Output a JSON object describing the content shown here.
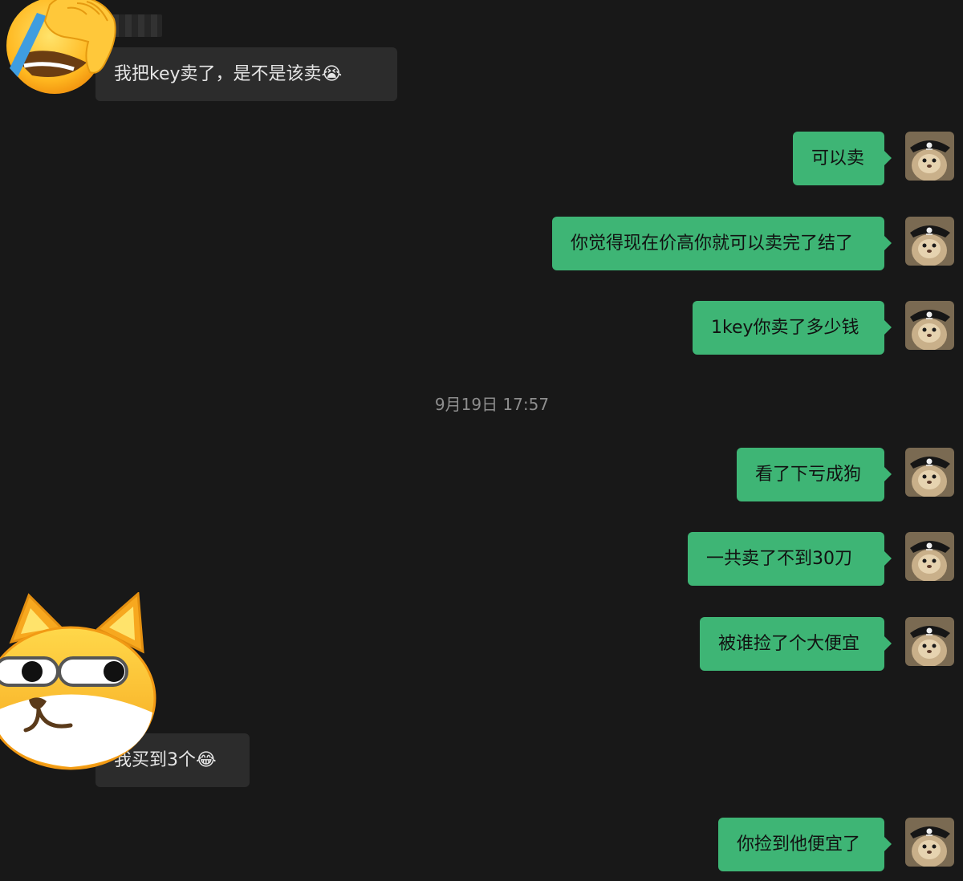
{
  "colors": {
    "background": "#181818",
    "incoming_bubble": "#2c2c2c",
    "outgoing_bubble": "#3eb575",
    "timestamp_text": "#8e8e8e"
  },
  "messages": [
    {
      "from": "other",
      "text": "我把key卖了，是不是该卖😭",
      "avatar_icon": "facepalm-emoji-icon"
    },
    {
      "from": "me",
      "text": "可以卖"
    },
    {
      "from": "me",
      "text": "你觉得现在价高你就可以卖完了结了"
    },
    {
      "from": "me",
      "text": "1key你卖了多少钱"
    },
    {
      "timestamp": "9月19日 17:57"
    },
    {
      "from": "me",
      "text": "看了下亏成狗"
    },
    {
      "from": "me",
      "text": "一共卖了不到30刀"
    },
    {
      "from": "me",
      "text": "被谁捡了个大便宜"
    },
    {
      "from": "other",
      "text": "我买到3个😂",
      "avatar_icon": "shiba-smirk-emoji-icon"
    },
    {
      "from": "me",
      "text": "你捡到他便宜了"
    }
  ],
  "my_avatar_icon": "pirate-cat-avatar-icon"
}
